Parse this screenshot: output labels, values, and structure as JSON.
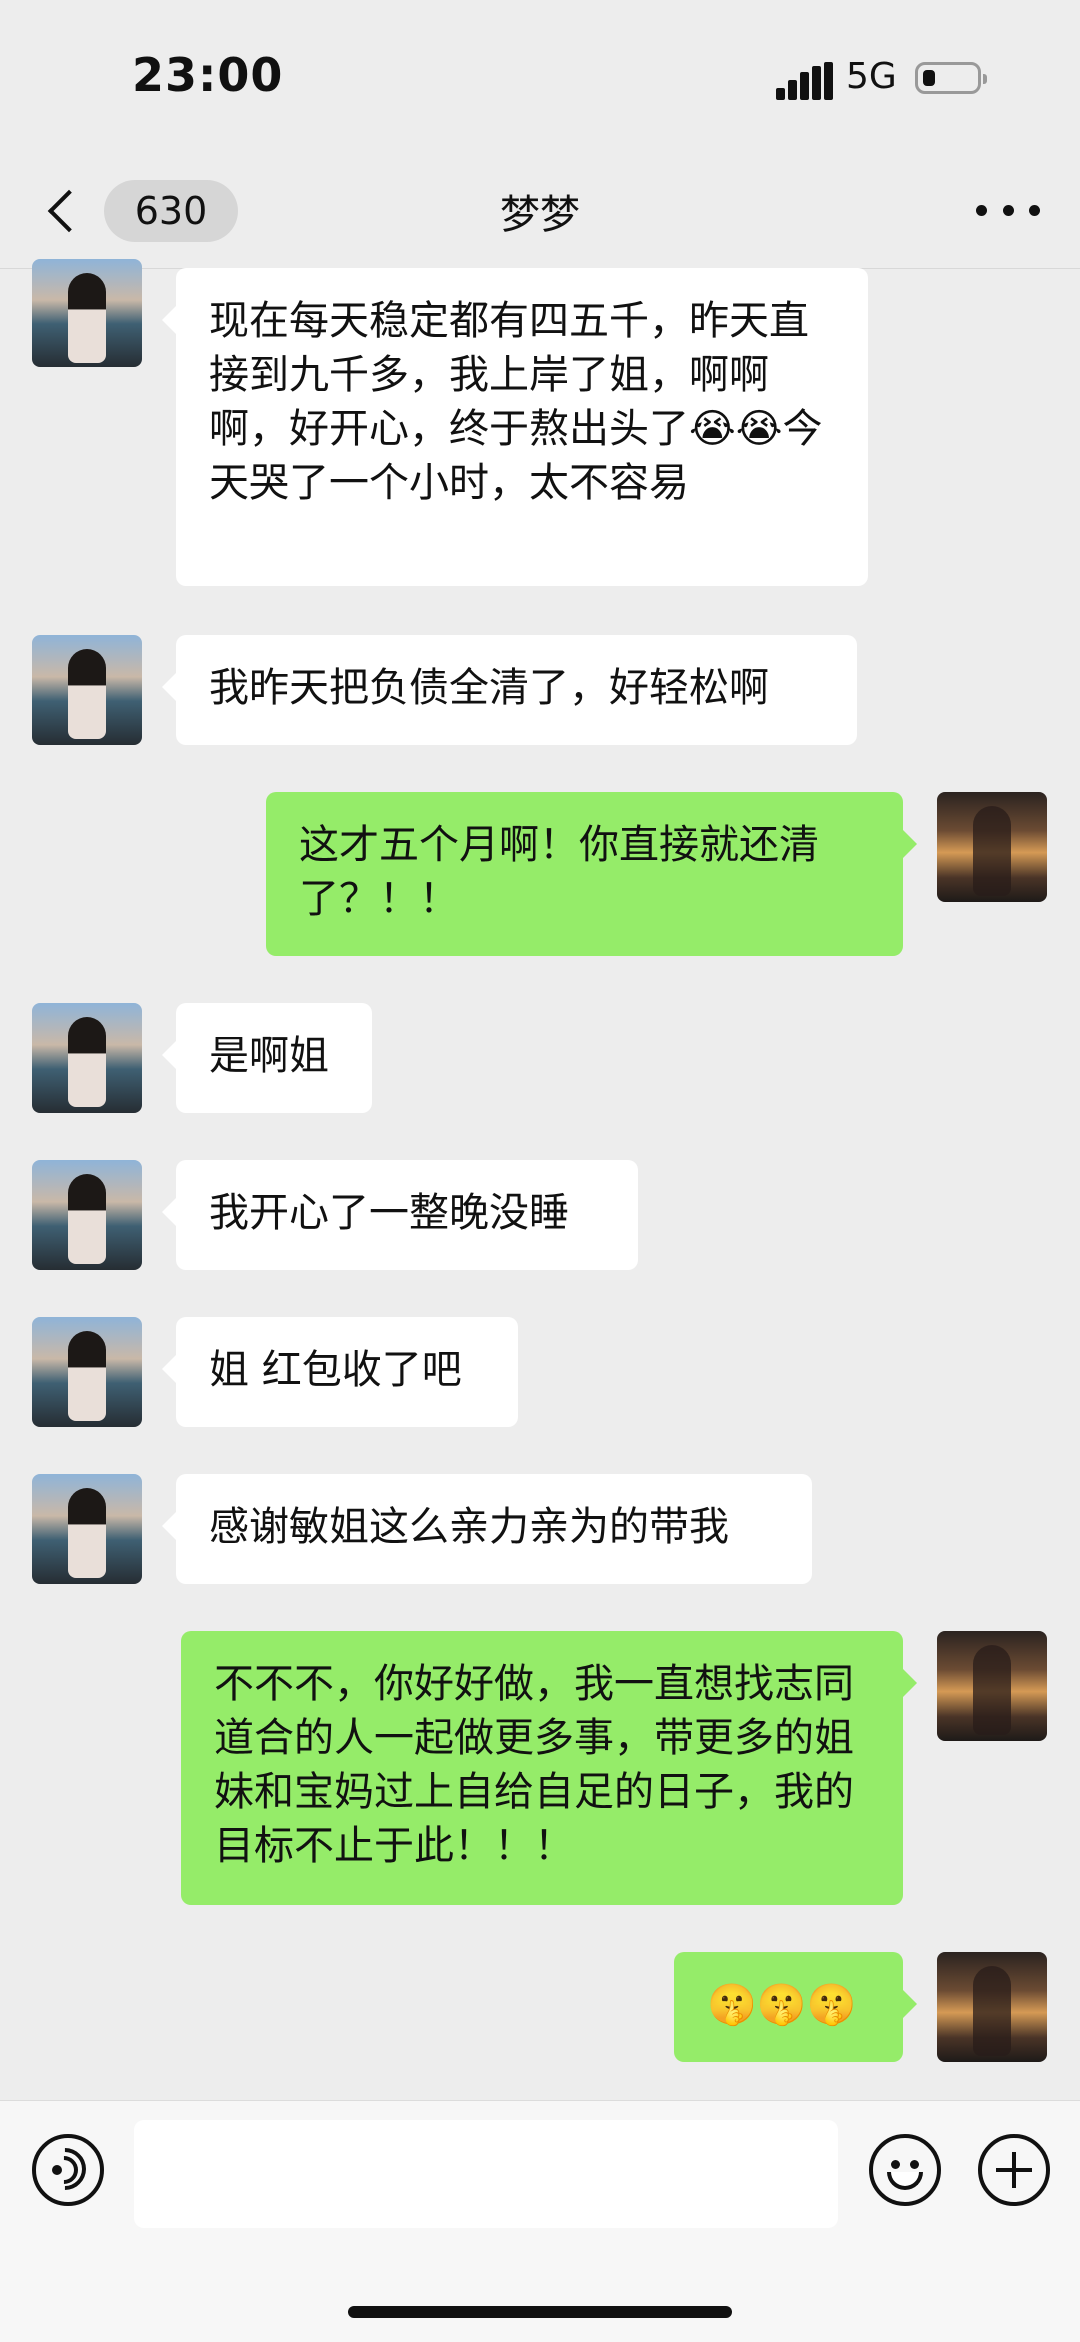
{
  "status_bar": {
    "time": "23:00",
    "network": "5G"
  },
  "nav": {
    "unread_count": "630",
    "title": "梦梦",
    "back_icon": "chevron-left-icon",
    "more_icon": "more-dots-icon"
  },
  "messages": [
    {
      "sender": "them",
      "text": "现在每天稳定都有四五千，昨天直接到九千多，我上岸了姐，啊啊啊，好开心，终于熬出头了😭😭今天哭了一个小时，太不容易"
    },
    {
      "sender": "them",
      "text": "我昨天把负债全清了，好轻松啊"
    },
    {
      "sender": "me",
      "text": "这才五个月啊！你直接就还清了？！！"
    },
    {
      "sender": "them",
      "text": "是啊姐"
    },
    {
      "sender": "them",
      "text": "我开心了一整晚没睡"
    },
    {
      "sender": "them",
      "text": "姐 红包收了吧"
    },
    {
      "sender": "them",
      "text": "感谢敏姐这么亲力亲为的带我"
    },
    {
      "sender": "me",
      "text": "不不不，你好好做，我一直想找志同道合的人一起做更多事，带更多的姐妹和宝妈过上自给自足的日子，我的目标不止于此！！！"
    },
    {
      "sender": "me",
      "text": "🤫🤫🤫"
    }
  ],
  "input_bar": {
    "placeholder": "",
    "voice_icon": "voice-icon",
    "emoji_icon": "emoji-icon",
    "add_icon": "plus-icon"
  },
  "colors": {
    "background": "#ededed",
    "my_bubble": "#95ec69",
    "their_bubble": "#ffffff"
  }
}
